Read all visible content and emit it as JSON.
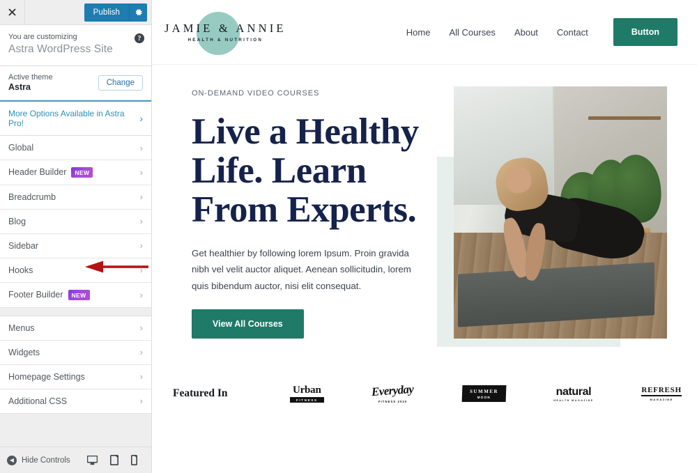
{
  "customizer": {
    "topbar": {
      "close_icon": "close-icon",
      "publish_label": "Publish",
      "gear_icon": "gear-icon"
    },
    "header": {
      "subtitle": "You are customizing",
      "title": "Astra WordPress Site",
      "help_icon": "?"
    },
    "theme": {
      "label": "Active theme",
      "name": "Astra",
      "change_label": "Change"
    },
    "pro_banner": {
      "label": "More Options Available in Astra Pro!",
      "chevron": "›"
    },
    "sections": [
      {
        "label": "Global",
        "badge": null,
        "chevron": "›"
      },
      {
        "label": "Header Builder",
        "badge": "NEW",
        "chevron": "›"
      },
      {
        "label": "Breadcrumb",
        "badge": null,
        "chevron": "›"
      },
      {
        "label": "Blog",
        "badge": null,
        "chevron": "›"
      },
      {
        "label": "Sidebar",
        "badge": null,
        "chevron": "›"
      },
      {
        "label": "Hooks",
        "badge": null,
        "chevron": "›"
      },
      {
        "label": "Footer Builder",
        "badge": "NEW",
        "chevron": "›"
      }
    ],
    "sections2": [
      {
        "label": "Menus",
        "badge": null,
        "chevron": "›"
      },
      {
        "label": "Widgets",
        "badge": null,
        "chevron": "›"
      },
      {
        "label": "Homepage Settings",
        "badge": null,
        "chevron": "›"
      },
      {
        "label": "Additional CSS",
        "badge": null,
        "chevron": "›"
      }
    ],
    "footer": {
      "hide_controls_label": "Hide Controls",
      "devices": [
        "desktop-icon",
        "tablet-icon",
        "mobile-icon"
      ]
    },
    "colors": {
      "publish_blue": "#1e7cb0",
      "pro_teal": "#2c8fb5",
      "badge_purple": "#8338d6",
      "annotation_red": "#b51212"
    }
  },
  "site": {
    "logo": {
      "name": "JAMIE & ANNIE",
      "tagline": "HEALTH & NUTRITION",
      "circle_color": "#8ec7bd"
    },
    "nav": [
      {
        "label": "Home"
      },
      {
        "label": "All Courses"
      },
      {
        "label": "About"
      },
      {
        "label": "Contact"
      }
    ],
    "nav_button": "Button",
    "hero": {
      "eyebrow": "ON-DEMAND VIDEO COURSES",
      "title": "Live a Healthy Life. Learn From Experts.",
      "paragraph": "Get healthier by following lorem Ipsum. Proin gravida nibh vel velit auctor aliquet. Aenean sollicitudin, lorem quis bibendum auctor, nisi elit consequat.",
      "cta": "View All Courses",
      "image_alt": "woman-doing-yoga-plank-pose-in-plant-filled-studio",
      "accent_color": "#e6efec",
      "button_color": "#1f7a68",
      "title_color": "#15224b"
    },
    "featured": {
      "label": "Featured In",
      "logos": [
        {
          "name": "urban-fitness-logo",
          "main": "Urban",
          "sub": "FITNESS"
        },
        {
          "name": "everyday-fitness-logo",
          "main": "Everyday",
          "sub": "FITNESS 2020"
        },
        {
          "name": "summer-moon-logo",
          "main": "SUMMER",
          "sub": "MOON"
        },
        {
          "name": "natural-logo",
          "main": "natural",
          "sub": "HEALTH MAGAZINE"
        },
        {
          "name": "refresh-magazine-logo",
          "main": "REFRESH",
          "sub": "MAGAZINE"
        }
      ]
    }
  }
}
